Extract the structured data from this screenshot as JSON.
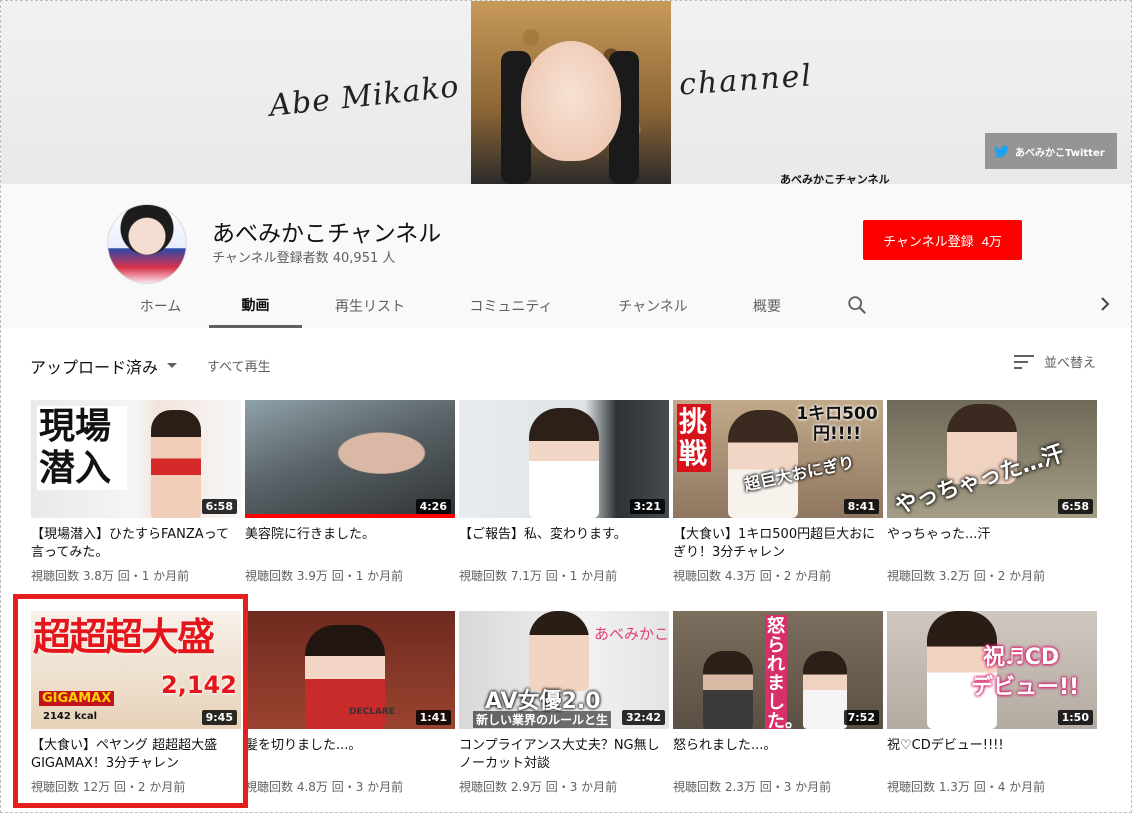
{
  "banner": {
    "script_left": "Abe Mikako",
    "script_right": "channel",
    "caption": "あべみかこチャンネル",
    "twitter_label": "あべみかこTwitter"
  },
  "channel": {
    "name": "あべみかこチャンネル",
    "subscribers": "チャンネル登録者数 40,951 人",
    "subscribe_label": "チャンネル登録",
    "subscribe_count": "4万"
  },
  "tabs": [
    {
      "label": "ホーム"
    },
    {
      "label": "動画"
    },
    {
      "label": "再生リスト"
    },
    {
      "label": "コミュニティ"
    },
    {
      "label": "チャンネル"
    },
    {
      "label": "概要"
    }
  ],
  "toolbar": {
    "uploads_label": "アップロード済み",
    "play_all": "すべて再生",
    "sort_label": "並べ替え"
  },
  "videos": [
    {
      "title": "【現場潜入】ひたすらFANZAって言ってみた。",
      "meta": "視聴回数 3.8万 回・1 か月前",
      "duration": "6:58",
      "thumb_text": "現場潜入"
    },
    {
      "title": "美容院に行きました。",
      "meta": "視聴回数 3.9万 回・1 か月前",
      "duration": "4:26",
      "watched": 1.0
    },
    {
      "title": "【ご報告】私、変わります。",
      "meta": "視聴回数 7.1万 回・1 か月前",
      "duration": "3:21"
    },
    {
      "title": "【大食い】1キロ500円超巨大おにぎり！3分チャレン",
      "meta": "視聴回数 4.3万 回・2 か月前",
      "duration": "8:41",
      "thumb_text": "挑戦",
      "thumb_text2": "1キロ500円!!!!",
      "thumb_text3": "超巨大おにぎり"
    },
    {
      "title": "やっちゃった...汗",
      "meta": "視聴回数 3.2万 回・2 か月前",
      "duration": "6:58",
      "thumb_text": "やっちゃった…汗"
    },
    {
      "title": "【大食い】ペヤング 超超超大盛GIGAMAX！3分チャレン",
      "meta": "視聴回数 12万 回・2 か月前",
      "duration": "9:45",
      "thumb_text": "超超超大盛",
      "thumb_text2": "2,142",
      "thumb_text3": "GIGAMAX",
      "thumb_text4": "2142 kcal"
    },
    {
      "title": "髪を切りました...。",
      "meta": "視聴回数 4.8万 回・3 か月前",
      "duration": "1:41",
      "thumb_text": "DECLARE"
    },
    {
      "title": "コンプライアンス大丈夫？NG無しノーカット対談",
      "meta": "視聴回数 2.9万 回・3 か月前",
      "duration": "32:42",
      "thumb_text": "AV女優2.0",
      "thumb_text2": "新しい業界のルールと生",
      "thumb_text3": "あべみかこ"
    },
    {
      "title": "怒られました...。",
      "meta": "視聴回数 2.3万 回・3 か月前",
      "duration": "7:52",
      "thumb_text": "怒られました。"
    },
    {
      "title": "祝♡CDデビュー!!!!",
      "meta": "視聴回数 1.3万 回・4 か月前",
      "duration": "1:50",
      "thumb_text": "祝♬CD",
      "thumb_text2": "デビュー!!"
    }
  ],
  "colors": {
    "brand_red": "#ff0000",
    "highlight": "#e51e1e"
  }
}
